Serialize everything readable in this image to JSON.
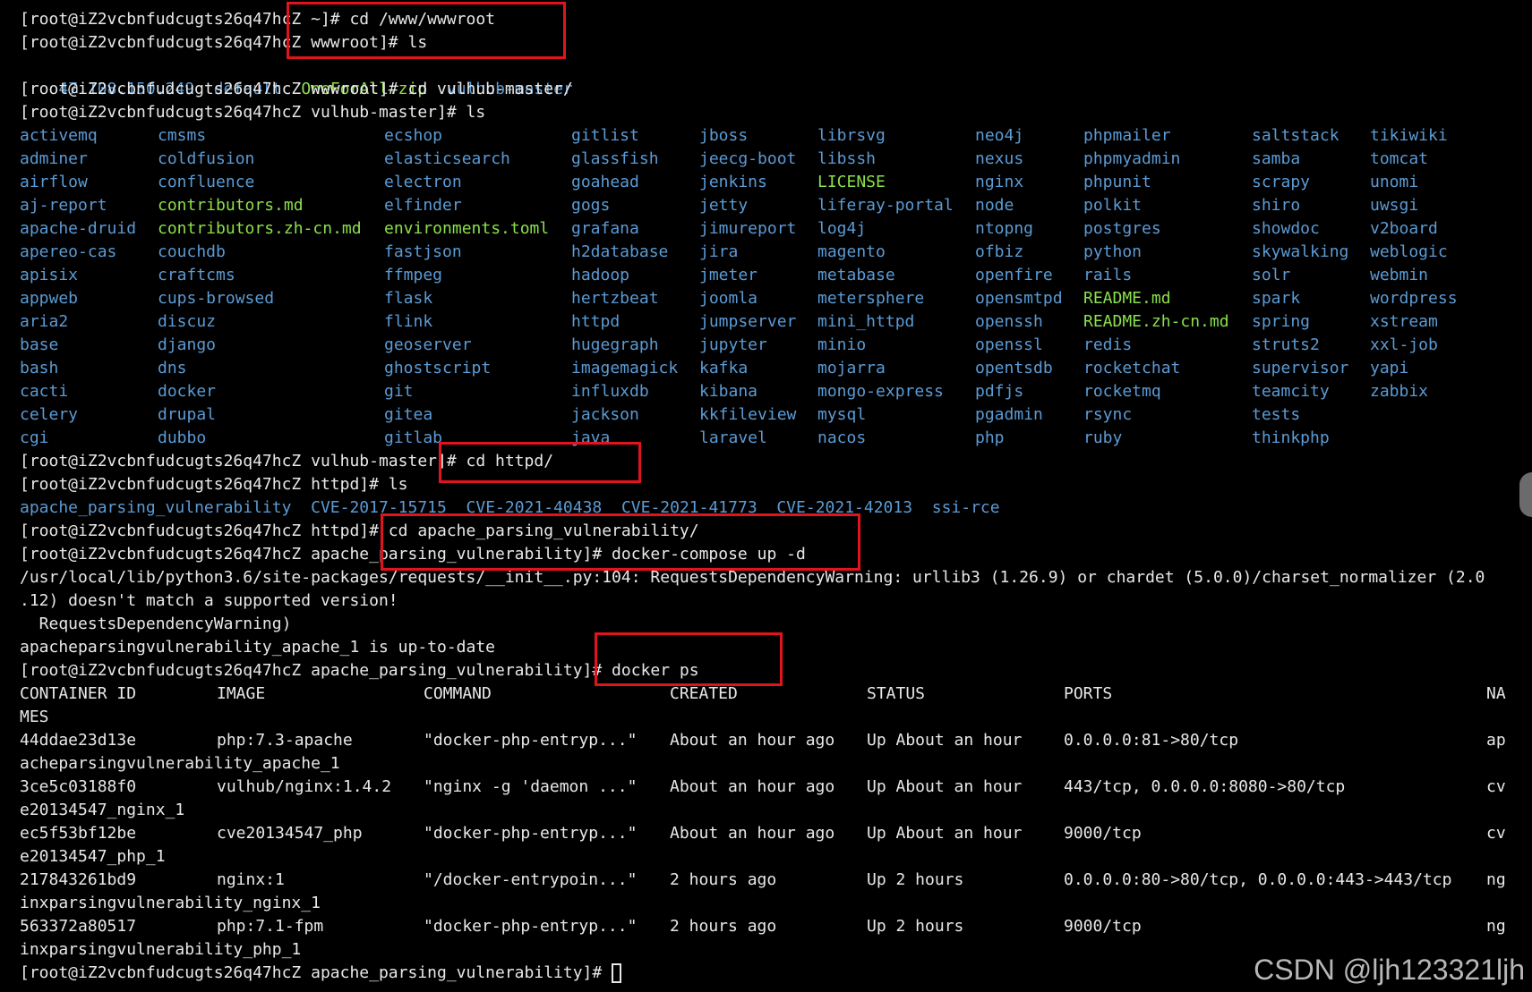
{
  "colors": {
    "background": "#000000",
    "text": "#e8e8e8",
    "directory": "#5b9bd5",
    "file": "#8be04b",
    "highlight_box": "#e0141c"
  },
  "lines": {
    "l0": "[root@iZ2vcbnfudcugts26q47hcZ ~]# cd /www/wwwroot",
    "l1": "[root@iZ2vcbnfudcugts26q47hcZ wwwroot]# ls",
    "l3": "[root@iZ2vcbnfudcugts26q47hcZ wwwroot]# cd vulhub-master/",
    "l4": "[root@iZ2vcbnfudcugts26q47hcZ vulhub-master]# ls",
    "l19": "[root@iZ2vcbnfudcugts26q47hcZ vulhub-master]# cd httpd/",
    "l20": "[root@iZ2vcbnfudcugts26q47hcZ httpd]# ls",
    "l22": "[root@iZ2vcbnfudcugts26q47hcZ httpd]# cd apache_parsing_vulnerability/",
    "l23": "[root@iZ2vcbnfudcugts26q47hcZ apache_parsing_vulnerability]# docker-compose up -d",
    "l24": "/usr/local/lib/python3.6/site-packages/requests/__init__.py:104: RequestsDependencyWarning: urllib3 (1.26.9) or chardet (5.0.0)/charset_normalizer (2.0",
    "l25": ".12) doesn't match a supported version!",
    "l26": "  RequestsDependencyWarning)",
    "l27": "apacheparsingvulnerability_apache_1 is up-to-date",
    "l28": "[root@iZ2vcbnfudcugts26q47hcZ apache_parsing_vulnerability]# docker ps",
    "l41": "[root@iZ2vcbnfudcugts26q47hcZ apache_parsing_vulnerability]# "
  },
  "wwwroot_listing": [
    {
      "name": "47.108.150.249",
      "kind": "dir"
    },
    {
      "name": "default",
      "kind": "dir"
    },
    {
      "name": "OneForAll.zip",
      "kind": "file"
    },
    {
      "name": "vulhub-master",
      "kind": "dir"
    }
  ],
  "vulhub_listing": [
    [
      "activemq",
      "adminer",
      "airflow",
      "aj-report",
      "apache-druid",
      "apereo-cas",
      "apisix",
      "appweb",
      "aria2",
      "base",
      "bash",
      "cacti",
      "celery",
      "cgi"
    ],
    [
      "cmsms",
      "coldfusion",
      "confluence",
      "contributors.md",
      "contributors.zh-cn.md",
      "couchdb",
      "craftcms",
      "cups-browsed",
      "discuz",
      "django",
      "dns",
      "docker",
      "drupal",
      "dubbo"
    ],
    [
      "ecshop",
      "elasticsearch",
      "electron",
      "elfinder",
      "environments.toml",
      "fastjson",
      "ffmpeg",
      "flask",
      "flink",
      "geoserver",
      "ghostscript",
      "git",
      "gitea",
      "gitlab"
    ],
    [
      "gitlist",
      "glassfish",
      "goahead",
      "gogs",
      "grafana",
      "h2database",
      "hadoop",
      "hertzbeat",
      "httpd",
      "hugegraph",
      "imagemagick",
      "influxdb",
      "jackson",
      "java"
    ],
    [
      "jboss",
      "jeecg-boot",
      "jenkins",
      "jetty",
      "jimureport",
      "jira",
      "jmeter",
      "joomla",
      "jumpserver",
      "jupyter",
      "kafka",
      "kibana",
      "kkfileview",
      "laravel"
    ],
    [
      "librsvg",
      "libssh",
      "LICENSE",
      "liferay-portal",
      "log4j",
      "magento",
      "metabase",
      "metersphere",
      "mini_httpd",
      "minio",
      "mojarra",
      "mongo-express",
      "mysql",
      "nacos"
    ],
    [
      "neo4j",
      "nexus",
      "nginx",
      "node",
      "ntopng",
      "ofbiz",
      "openfire",
      "opensmtpd",
      "openssh",
      "openssl",
      "opentsdb",
      "pdfjs",
      "pgadmin",
      "php"
    ],
    [
      "phpmailer",
      "phpmyadmin",
      "phpunit",
      "polkit",
      "postgres",
      "python",
      "rails",
      "README.md",
      "README.zh-cn.md",
      "redis",
      "rocketchat",
      "rocketmq",
      "rsync",
      "ruby"
    ],
    [
      "saltstack",
      "samba",
      "scrapy",
      "shiro",
      "showdoc",
      "skywalking",
      "solr",
      "spark",
      "spring",
      "struts2",
      "supervisor",
      "teamcity",
      "tests",
      "thinkphp"
    ],
    [
      "tikiwiki",
      "tomcat",
      "unomi",
      "uwsgi",
      "v2board",
      "weblogic",
      "webmin",
      "wordpress",
      "xstream",
      "xxl-job",
      "yapi",
      "zabbix"
    ]
  ],
  "vulhub_files": [
    "contributors.md",
    "contributors.zh-cn.md",
    "environments.toml",
    "LICENSE",
    "README.md",
    "README.zh-cn.md"
  ],
  "httpd_listing": [
    "apache_parsing_vulnerability",
    "CVE-2017-15715",
    "CVE-2021-40438",
    "CVE-2021-41773",
    "CVE-2021-42013",
    "ssi-rce"
  ],
  "docker_ps": {
    "headers": [
      "CONTAINER ID",
      "IMAGE",
      "COMMAND",
      "CREATED",
      "STATUS",
      "PORTS",
      "NA"
    ],
    "header_wrap": "MES",
    "rows": [
      {
        "id": "44ddae23d13e",
        "image": "php:7.3-apache",
        "command": "\"docker-php-entryp...\"",
        "created": "About an hour ago",
        "status": "Up About an hour",
        "ports": "0.0.0.0:81->80/tcp",
        "name_a": "ap",
        "name_b": "acheparsingvulnerability_apache_1"
      },
      {
        "id": "3ce5c03188f0",
        "image": "vulhub/nginx:1.4.2",
        "command": "\"nginx -g 'daemon ...\"",
        "created": "About an hour ago",
        "status": "Up About an hour",
        "ports": "443/tcp, 0.0.0.0:8080->80/tcp",
        "name_a": "cv",
        "name_b": "e20134547_nginx_1"
      },
      {
        "id": "ec5f53bf12be",
        "image": "cve20134547_php",
        "command": "\"docker-php-entryp...\"",
        "created": "About an hour ago",
        "status": "Up About an hour",
        "ports": "9000/tcp",
        "name_a": "cv",
        "name_b": "e20134547_php_1"
      },
      {
        "id": "217843261bd9",
        "image": "nginx:1",
        "command": "\"/docker-entrypoin...\"",
        "created": "2 hours ago",
        "status": "Up 2 hours",
        "ports": "0.0.0.0:80->80/tcp, 0.0.0.0:443->443/tcp",
        "name_a": "ng",
        "name_b": "inxparsingvulnerability_nginx_1"
      },
      {
        "id": "563372a80517",
        "image": "php:7.1-fpm",
        "command": "\"docker-php-entryp...\"",
        "created": "2 hours ago",
        "status": "Up 2 hours",
        "ports": "9000/tcp",
        "name_a": "ng",
        "name_b": "inxparsingvulnerability_php_1"
      }
    ]
  },
  "watermark": "CSDN @ljh123321ljh"
}
